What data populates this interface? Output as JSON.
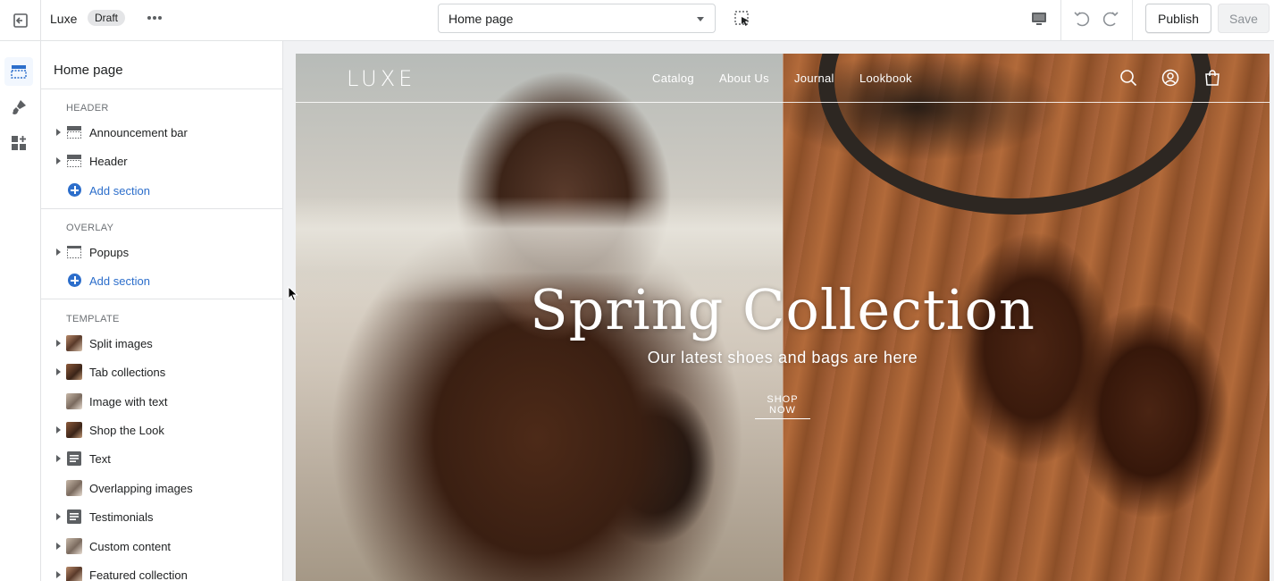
{
  "topbar": {
    "store_name": "Luxe",
    "status_badge": "Draft",
    "page_select": "Home page",
    "publish_label": "Publish",
    "save_label": "Save"
  },
  "sidebar": {
    "title": "Home page",
    "groups": [
      {
        "label": "HEADER",
        "items": [
          {
            "label": "Announcement bar",
            "icon": "section-bar-icon",
            "expandable": true
          },
          {
            "label": "Header",
            "icon": "section-bar-icon",
            "expandable": true
          }
        ],
        "add_label": "Add section"
      },
      {
        "label": "OVERLAY",
        "items": [
          {
            "label": "Popups",
            "icon": "section-dashed-icon",
            "expandable": true
          }
        ],
        "add_label": "Add section"
      },
      {
        "label": "TEMPLATE",
        "items": [
          {
            "label": "Split images",
            "icon": "image-thumb-icon",
            "expandable": true
          },
          {
            "label": "Tab collections",
            "icon": "image-thumb-icon",
            "expandable": true
          },
          {
            "label": "Image with text",
            "icon": "image-thumb-icon",
            "expandable": false
          },
          {
            "label": "Shop the Look",
            "icon": "image-thumb-icon",
            "expandable": true
          },
          {
            "label": "Text",
            "icon": "text-block-icon",
            "expandable": true
          },
          {
            "label": "Overlapping images",
            "icon": "image-thumb-icon",
            "expandable": false
          },
          {
            "label": "Testimonials",
            "icon": "text-block-icon",
            "expandable": true
          },
          {
            "label": "Custom content",
            "icon": "image-thumb-icon",
            "expandable": true
          },
          {
            "label": "Featured collection",
            "icon": "image-thumb-icon",
            "expandable": true
          }
        ]
      }
    ]
  },
  "preview": {
    "logo": "LUXE",
    "nav": [
      "Catalog",
      "About Us",
      "Journal",
      "Lookbook"
    ],
    "hero_title": "Spring Collection",
    "hero_subtitle": "Our latest shoes and bags are here",
    "hero_cta": "SHOP NOW"
  },
  "colors": {
    "accent": "#2c6ecb",
    "border": "#e1e3e5",
    "text": "#202223",
    "muted": "#6d7175"
  }
}
